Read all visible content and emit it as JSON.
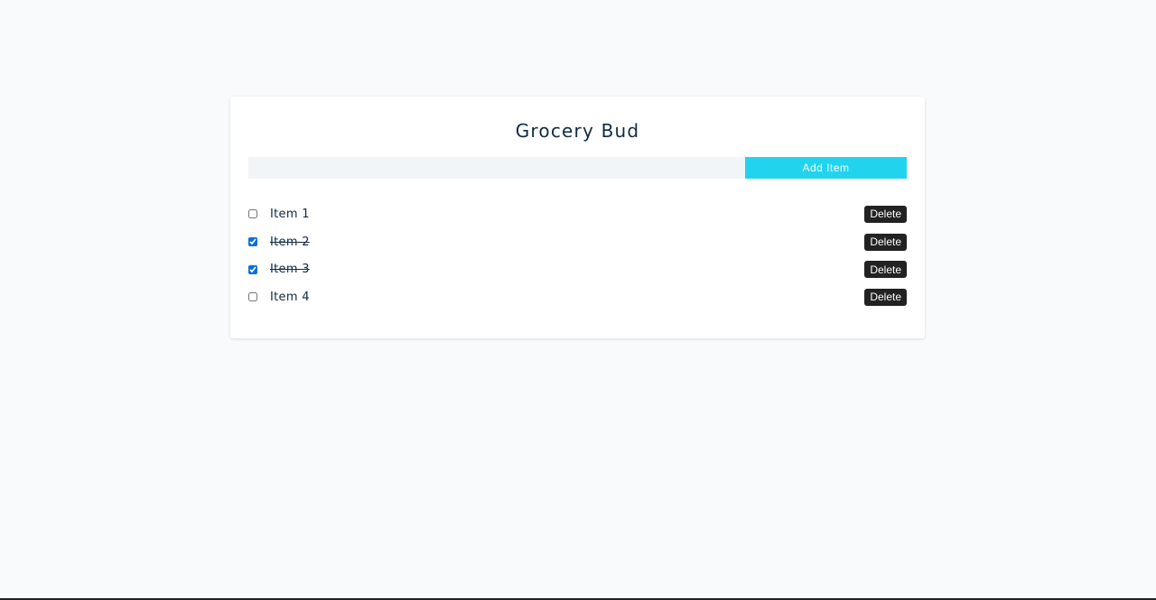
{
  "app": {
    "title": "Grocery Bud"
  },
  "form": {
    "input_value": "",
    "input_placeholder": "",
    "add_label": "Add Item"
  },
  "items": [
    {
      "label": "Item 1",
      "checked": false,
      "delete_label": "Delete"
    },
    {
      "label": "Item 2",
      "checked": true,
      "delete_label": "Delete"
    },
    {
      "label": "Item 3",
      "checked": true,
      "delete_label": "Delete"
    },
    {
      "label": "Item 4",
      "checked": false,
      "delete_label": "Delete"
    }
  ],
  "colors": {
    "accent": "#22d3ee",
    "delete": "#222222",
    "background": "#f8fafc",
    "input_bg": "#f1f5f8",
    "checkbox": "#0b6fe0"
  }
}
